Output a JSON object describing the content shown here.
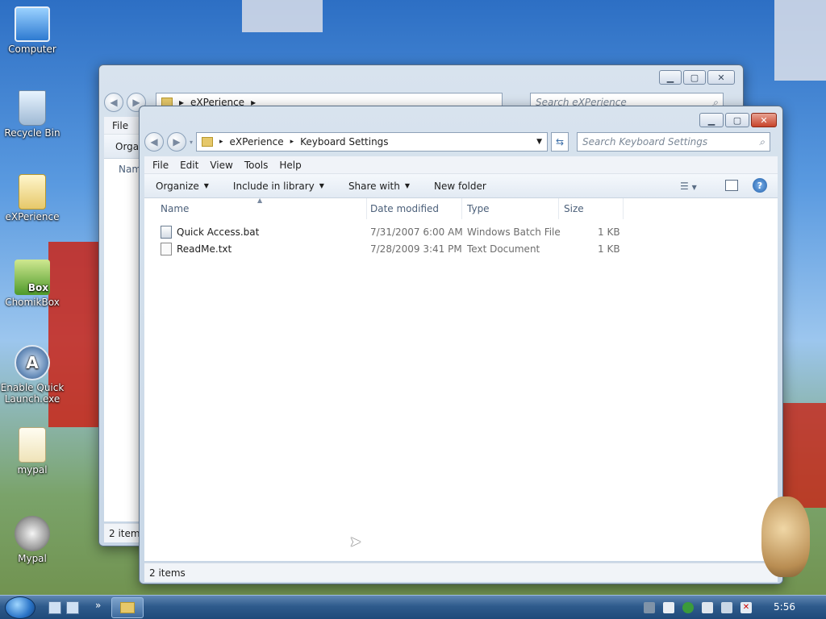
{
  "desktop": {
    "icons": [
      {
        "label": "Computer"
      },
      {
        "label": "Recycle Bin"
      },
      {
        "label": "eXPerience"
      },
      {
        "label": "ChomikBox"
      },
      {
        "label": "Enable Quick Launch.exe"
      },
      {
        "label": "mypal"
      },
      {
        "label": "Mypal"
      }
    ],
    "chomikbox_badge": "Box"
  },
  "back_window": {
    "breadcrumb": [
      "eXPerience"
    ],
    "search_placeholder": "Search eXPerience",
    "menu_file": "File",
    "toolbar_organize": "Orga",
    "column_name": "Nam",
    "status": "2 items"
  },
  "front_window": {
    "breadcrumb": [
      "eXPerience",
      "Keyboard Settings"
    ],
    "search_placeholder": "Search Keyboard Settings",
    "menu": [
      "File",
      "Edit",
      "View",
      "Tools",
      "Help"
    ],
    "toolbar": {
      "organize": "Organize",
      "include_in_library": "Include in library",
      "share_with": "Share with",
      "new_folder": "New folder"
    },
    "columns": [
      "Name",
      "Date modified",
      "Type",
      "Size"
    ],
    "files": [
      {
        "name": "Quick Access.bat",
        "date": "7/31/2007 6:00 AM",
        "type": "Windows Batch File",
        "size": "1 KB"
      },
      {
        "name": "ReadMe.txt",
        "date": "7/28/2009 3:41 PM",
        "type": "Text Document",
        "size": "1 KB"
      }
    ],
    "status": "2 items"
  },
  "taskbar": {
    "clock": "5:56",
    "overflow": "»"
  }
}
